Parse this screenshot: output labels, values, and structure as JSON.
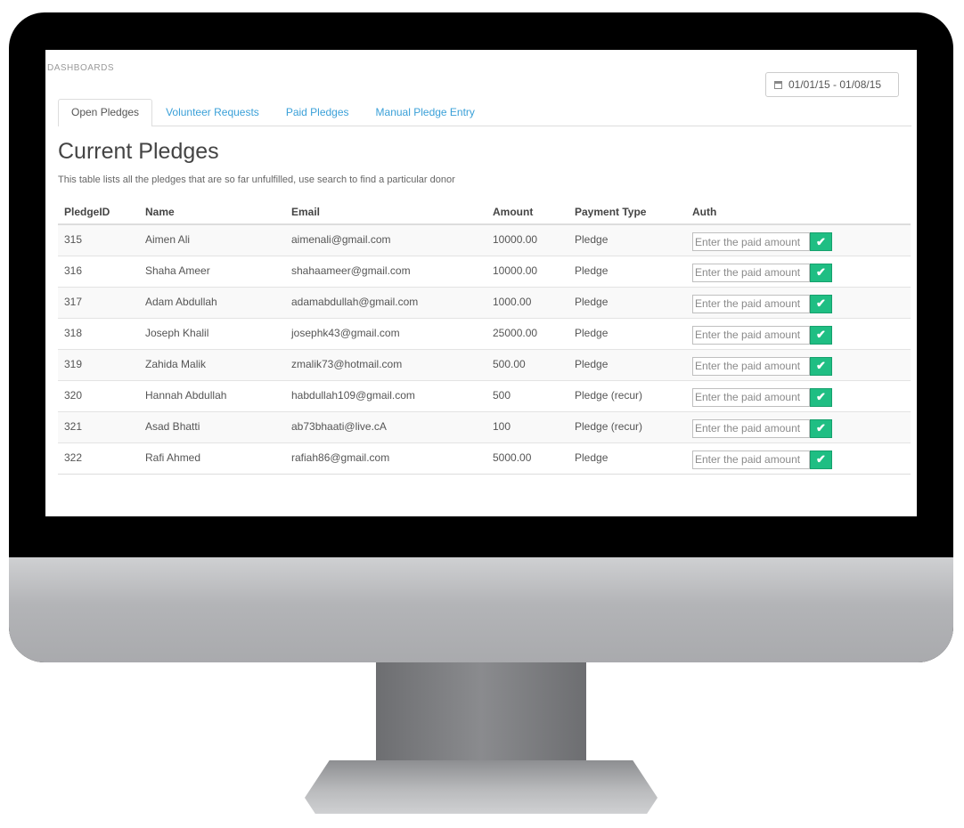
{
  "breadcrumb": "DASHBOARDS",
  "date_range": "01/01/15 - 01/08/15",
  "tabs": [
    {
      "label": "Open Pledges",
      "active": true
    },
    {
      "label": "Volunteer Requests",
      "active": false
    },
    {
      "label": "Paid Pledges",
      "active": false
    },
    {
      "label": "Manual Pledge Entry",
      "active": false
    }
  ],
  "page_title": "Current Pledges",
  "description": "This table lists all the pledges that are so far unfulfilled, use search to find a particular donor",
  "table": {
    "columns": [
      "PledgeID",
      "Name",
      "Email",
      "Amount",
      "Payment Type",
      "Auth"
    ],
    "rows": [
      {
        "id": "315",
        "name": "Aimen Ali",
        "email": "aimenali@gmail.com",
        "amount": "10000.00",
        "type": "Pledge"
      },
      {
        "id": "316",
        "name": "Shaha Ameer",
        "email": "shahaameer@gmail.com",
        "amount": "10000.00",
        "type": "Pledge"
      },
      {
        "id": "317",
        "name": "Adam Abdullah",
        "email": "adamabdullah@gmail.com",
        "amount": "1000.00",
        "type": "Pledge"
      },
      {
        "id": "318",
        "name": "Joseph Khalil",
        "email": "josephk43@gmail.com",
        "amount": "25000.00",
        "type": "Pledge"
      },
      {
        "id": "319",
        "name": "Zahida Malik",
        "email": "zmalik73@hotmail.com",
        "amount": "500.00",
        "type": "Pledge"
      },
      {
        "id": "320",
        "name": "Hannah Abdullah",
        "email": "habdullah109@gmail.com",
        "amount": "500",
        "type": "Pledge (recur)"
      },
      {
        "id": "321",
        "name": "Asad Bhatti",
        "email": "ab73bhaati@live.cA",
        "amount": "100",
        "type": "Pledge (recur)"
      },
      {
        "id": "322",
        "name": "Rafi Ahmed",
        "email": "rafiah86@gmail.com",
        "amount": "5000.00",
        "type": "Pledge"
      }
    ]
  },
  "auth_placeholder": "Enter the paid amount",
  "icons": {
    "calendar": "calendar-icon",
    "check": "check-icon"
  },
  "colors": {
    "link": "#3aa0d8",
    "confirm": "#1fbe83"
  }
}
